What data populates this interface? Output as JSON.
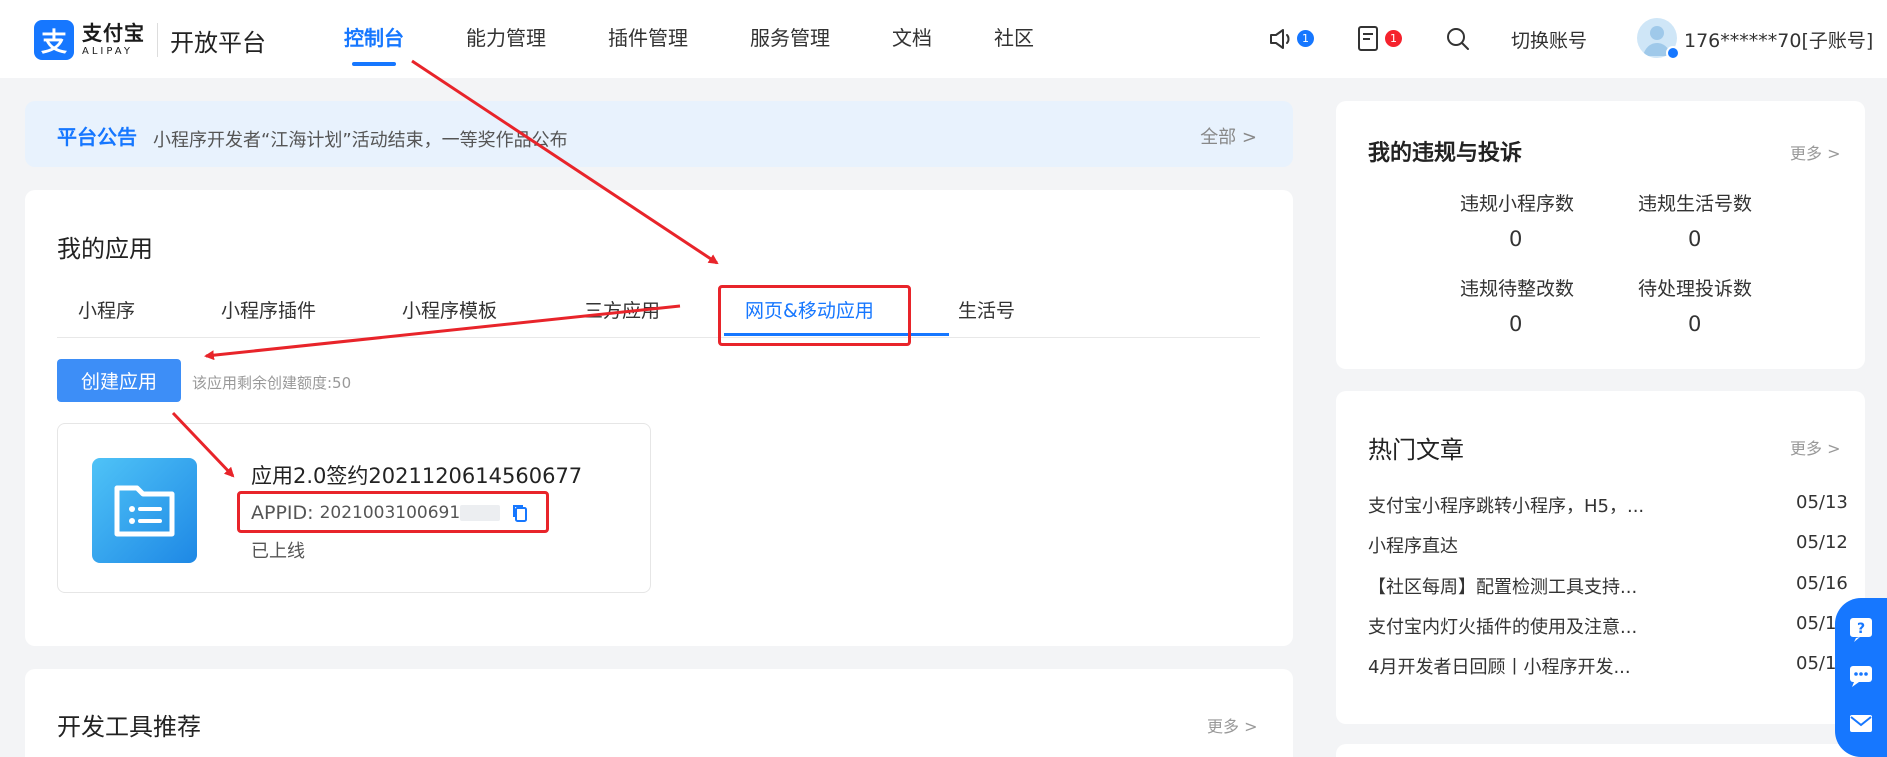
{
  "header": {
    "logo_cn": "支付宝",
    "logo_en": "ALIPAY",
    "platform": "开放平台",
    "nav": [
      "控制台",
      "能力管理",
      "插件管理",
      "服务管理",
      "文档",
      "社区"
    ],
    "active_nav_index": 0,
    "notify_count": "1",
    "message_count": "1",
    "switch_account": "切换账号",
    "user_name": "176******70[子账号]"
  },
  "announcement": {
    "tag": "平台公告",
    "text": "小程序开发者“江海计划”活动结束，一等奖作品公布",
    "more": "全部 >"
  },
  "my_apps": {
    "title": "我的应用",
    "tabs": [
      "小程序",
      "小程序插件",
      "小程序模板",
      "三方应用",
      "网页&移动应用",
      "生活号"
    ],
    "active_tab_index": 4,
    "create_button": "创建应用",
    "quota_text": "该应用剩余创建额度:50",
    "app": {
      "name": "应用2.0签约2021120614560677",
      "appid_label": "APPID:",
      "appid_value": "2021003100691",
      "status": "已上线"
    }
  },
  "dev_tools": {
    "title": "开发工具推荐",
    "more": "更多 >"
  },
  "violations": {
    "title": "我的违规与投诉",
    "more": "更多 >",
    "stats": [
      {
        "label": "违规小程序数",
        "value": "0"
      },
      {
        "label": "违规生活号数",
        "value": "0"
      },
      {
        "label": "违规待整改数",
        "value": "0"
      },
      {
        "label": "待处理投诉数",
        "value": "0"
      }
    ]
  },
  "hot_articles": {
    "title": "热门文章",
    "more": "更多 >",
    "items": [
      {
        "title": "支付宝小程序跳转小程序，H5，...",
        "date": "05/13"
      },
      {
        "title": "小程序直达",
        "date": "05/12"
      },
      {
        "title": "【社区每周】配置检测工具支持...",
        "date": "05/16"
      },
      {
        "title": "支付宝内灯火插件的使用及注意...",
        "date": "05/1"
      },
      {
        "title": "4月开发者日回顾丨小程序开发...",
        "date": "05/1"
      }
    ]
  },
  "colors": {
    "brand": "#1677ff",
    "annotation_red": "#e8242a",
    "badge_red": "#f5222d"
  },
  "icons": {
    "speaker": "speaker-icon",
    "message": "message-list-icon",
    "search": "search-icon",
    "copy": "copy-icon",
    "app": "folder-list-icon",
    "float": [
      "help-icon",
      "chat-icon",
      "mail-icon"
    ]
  }
}
